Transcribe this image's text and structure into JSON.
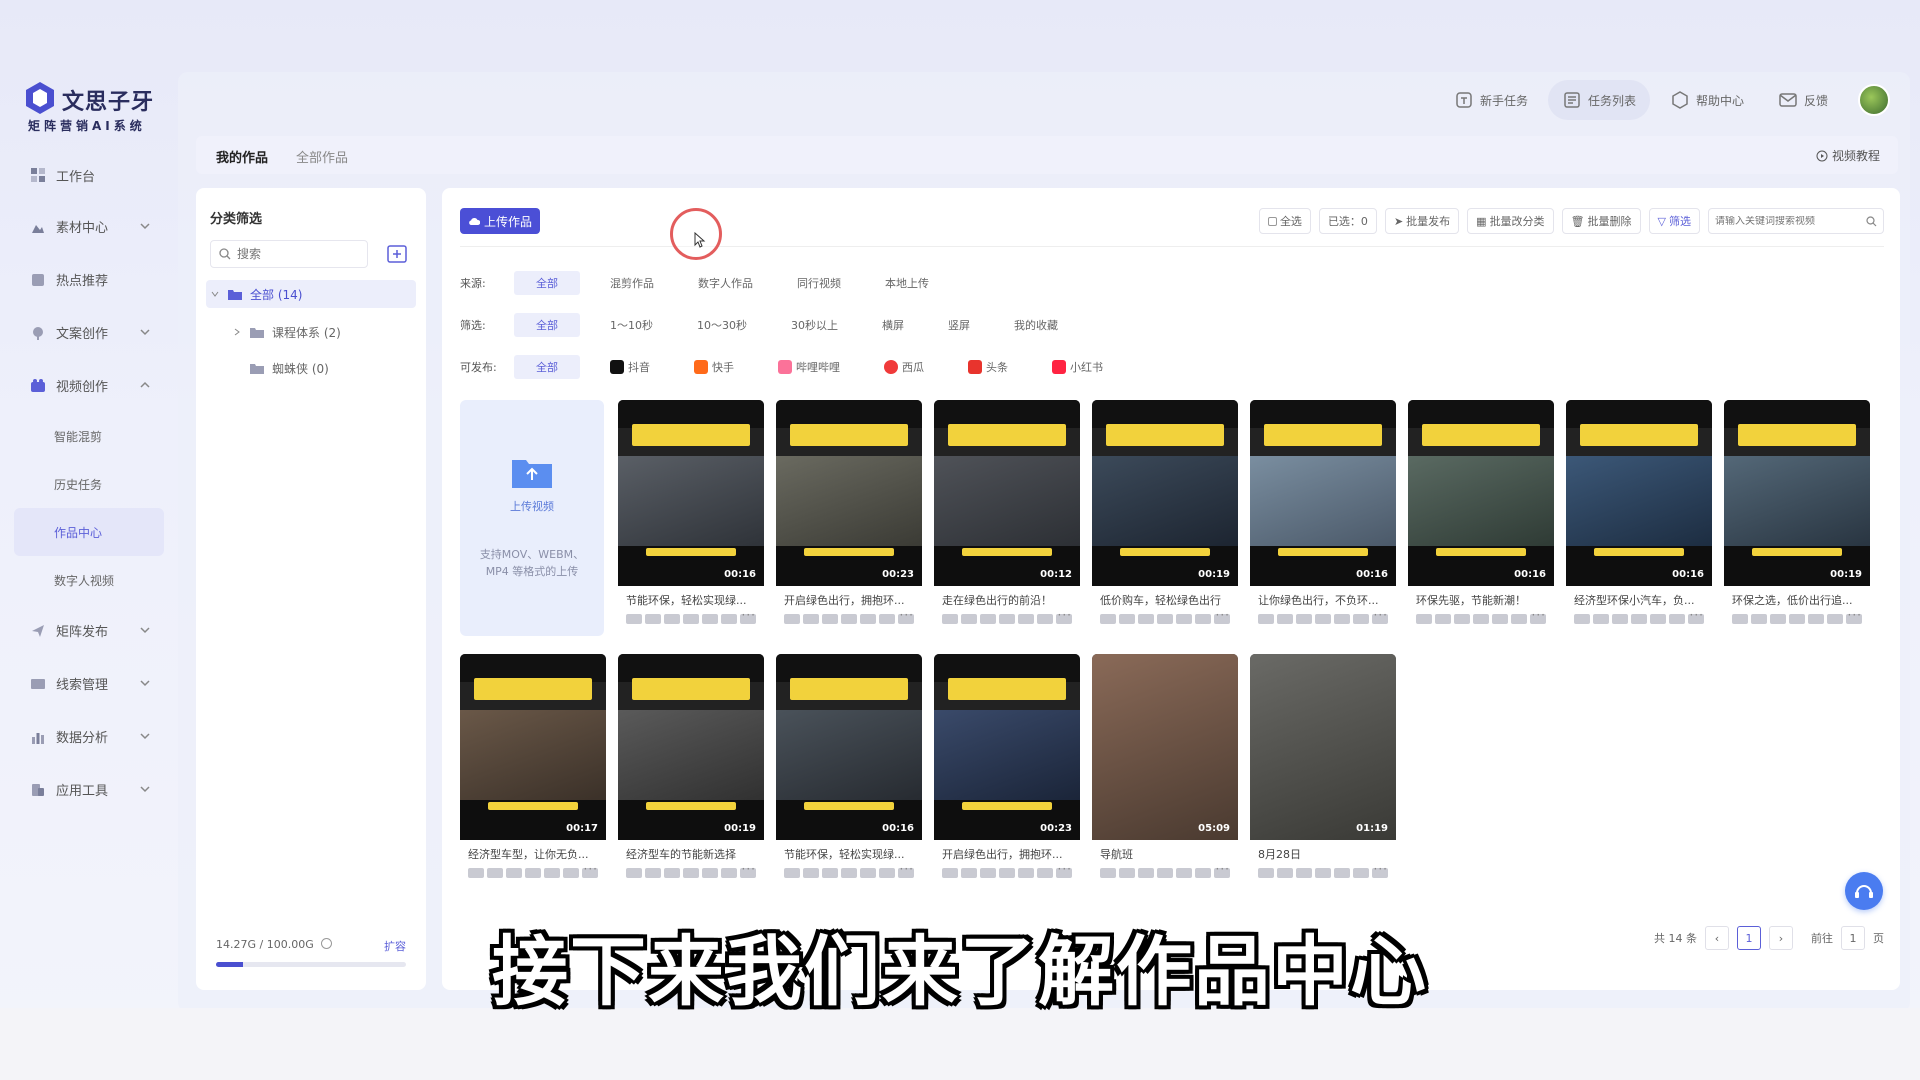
{
  "brand": {
    "name": "文思子牙",
    "slogan": "矩阵营销AI系统",
    "color": "#4a4fd0"
  },
  "sidebar": {
    "items": [
      {
        "label": "工作台",
        "icon": "dashboard-icon",
        "expandable": false
      },
      {
        "label": "素材中心",
        "icon": "material-icon",
        "expandable": true
      },
      {
        "label": "热点推荐",
        "icon": "hot-icon",
        "expandable": false
      },
      {
        "label": "文案创作",
        "icon": "copywriting-icon",
        "expandable": true
      },
      {
        "label": "视频创作",
        "icon": "video-icon",
        "expandable": true,
        "expanded": true
      },
      {
        "label": "矩阵发布",
        "icon": "publish-icon",
        "expandable": true
      },
      {
        "label": "线索管理",
        "icon": "leads-icon",
        "expandable": true
      },
      {
        "label": "数据分析",
        "icon": "chart-icon",
        "expandable": true
      },
      {
        "label": "应用工具",
        "icon": "tools-icon",
        "expandable": true
      }
    ],
    "video_sub": [
      "智能混剪",
      "历史任务",
      "作品中心",
      "数字人视频"
    ],
    "active_sub": "作品中心"
  },
  "topbar": {
    "items": [
      "新手任务",
      "任务列表",
      "帮助中心",
      "反馈"
    ],
    "active": "任务列表"
  },
  "tabs": {
    "items": [
      "我的作品",
      "全部作品"
    ],
    "active": "我的作品",
    "video_tutorial": "视频教程"
  },
  "category": {
    "title": "分类筛选",
    "search_placeholder": "搜索",
    "tree": [
      {
        "label": "全部 (14)",
        "level": 0,
        "selected": true
      },
      {
        "label": "课程体系 (2)",
        "level": 1,
        "selected": false
      },
      {
        "label": "蜘蛛侠 (0)",
        "level": 1,
        "selected": false
      }
    ],
    "storage_text": "14.27G / 100.00G",
    "storage_used_fraction": 0.1427,
    "expand_label": "扩容"
  },
  "works": {
    "upload_button": "上传作品",
    "actions": [
      "全选",
      "已选：0",
      "批量发布",
      "批量改分类",
      "批量删除",
      "筛选"
    ],
    "search_placeholder": "请输入关键词搜索视频",
    "filters": {
      "source": {
        "label": "来源:",
        "options": [
          "全部",
          "混剪作品",
          "数字人作品",
          "同行视频",
          "本地上传"
        ]
      },
      "duration": {
        "label": "筛选:",
        "options": [
          "全部",
          "1～10秒",
          "10～30秒",
          "30秒以上",
          "横屏",
          "竖屏",
          "我的收藏"
        ]
      },
      "platform": {
        "label": "可发布:",
        "options": [
          "全部",
          "抖音",
          "快手",
          "哔哩哔哩",
          "西瓜",
          "头条",
          "小红书"
        ]
      }
    },
    "upload_card": {
      "title": "上传视频",
      "formats": "支持MOV、WEBM、MP4 等格式的上传"
    },
    "videos": [
      {
        "title": "节能环保，轻松实现绿...",
        "duration": "00:16"
      },
      {
        "title": "开启绿色出行，拥抱环...",
        "duration": "00:23"
      },
      {
        "title": "走在绿色出行的前沿！",
        "duration": "00:12"
      },
      {
        "title": "低价购车，轻松绿色出行",
        "duration": "00:19"
      },
      {
        "title": "让你绿色出行，不负环...",
        "duration": "00:16"
      },
      {
        "title": "环保先驱，节能新潮！",
        "duration": "00:16"
      },
      {
        "title": "经济型环保小汽车，负...",
        "duration": "00:16"
      },
      {
        "title": "环保之选，低价出行追...",
        "duration": "00:19"
      },
      {
        "title": "经济型车型，让你无负...",
        "duration": "00:17"
      },
      {
        "title": "经济型车的节能新选择",
        "duration": "00:19"
      },
      {
        "title": "节能环保，轻松实现绿...",
        "duration": "00:16"
      },
      {
        "title": "开启绿色出行，拥抱环...",
        "duration": "00:23"
      },
      {
        "title": "导航班",
        "duration": "05:09"
      },
      {
        "title": "8月28日",
        "duration": "01:19"
      }
    ],
    "pagination": {
      "total": "共 14 条",
      "page": "1",
      "goto": "前往",
      "goto_value": "1",
      "unit": "页"
    }
  },
  "subtitle": "接下来我们来了解作品中心",
  "colors": {
    "accent": "#4b4fd6",
    "caption_yellow": "#f2d23c"
  }
}
